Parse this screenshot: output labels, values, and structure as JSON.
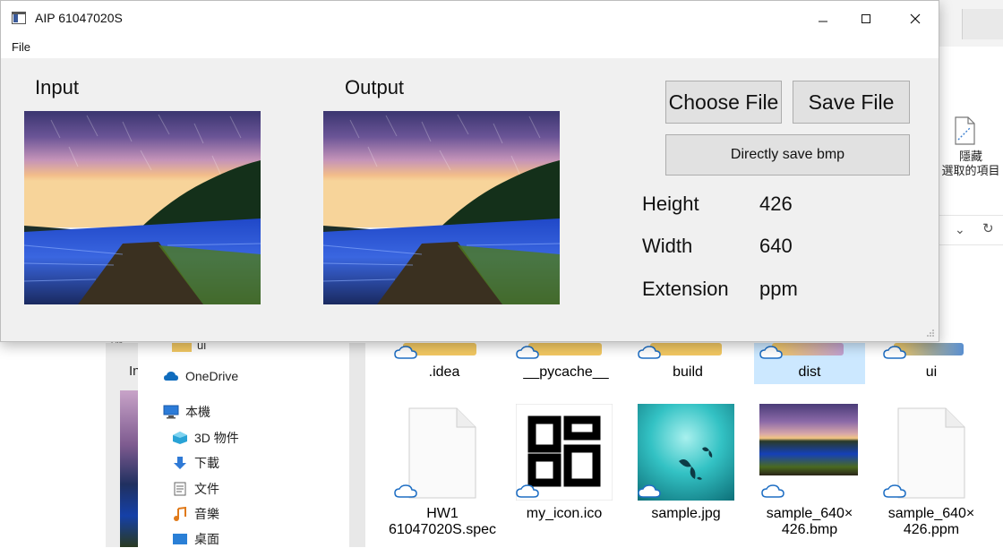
{
  "app": {
    "title": "AIP 61047020S",
    "menu": [
      "File"
    ],
    "input_label": "Input",
    "output_label": "Output",
    "buttons": {
      "choose_file": "Choose File",
      "save_file": "Save File",
      "directly_save": "Directly save bmp"
    },
    "info": [
      {
        "label": "Height",
        "value": "426"
      },
      {
        "label": "Width",
        "value": "640"
      },
      {
        "label": "Extension",
        "value": "ppm"
      }
    ]
  },
  "explorer": {
    "ribbon_hide_label": "隱藏\n選取的項目",
    "inner_tag": "File",
    "inner_label": "In",
    "nav_top_label": "ui",
    "nav_items": [
      {
        "label": "OneDrive",
        "icon": "onedrive-cloud-icon"
      },
      {
        "label": "本機",
        "icon": "computer-icon"
      },
      {
        "label": "3D 物件",
        "icon": "3d-objects-icon"
      },
      {
        "label": "下載",
        "icon": "download-arrow-icon"
      },
      {
        "label": "文件",
        "icon": "document-icon"
      },
      {
        "label": "音樂",
        "icon": "music-note-icon"
      },
      {
        "label": "桌面",
        "icon": "desktop-icon"
      }
    ],
    "folders": [
      ".idea",
      "__pycache__",
      "build",
      "dist",
      "ui"
    ],
    "files": [
      {
        "label": "HW1\n61047020S.spec",
        "type": "document"
      },
      {
        "label": "my_icon.ico",
        "type": "icon"
      },
      {
        "label": "sample.jpg",
        "type": "image"
      },
      {
        "label": "sample_640×\n426.bmp",
        "type": "image"
      },
      {
        "label": "sample_640×\n426.ppm",
        "type": "document"
      }
    ]
  },
  "colors": {
    "folder": "#f2c862",
    "selection": "#cce8ff",
    "button": "#e1e1e1",
    "window_bg": "#f0f0f0"
  }
}
